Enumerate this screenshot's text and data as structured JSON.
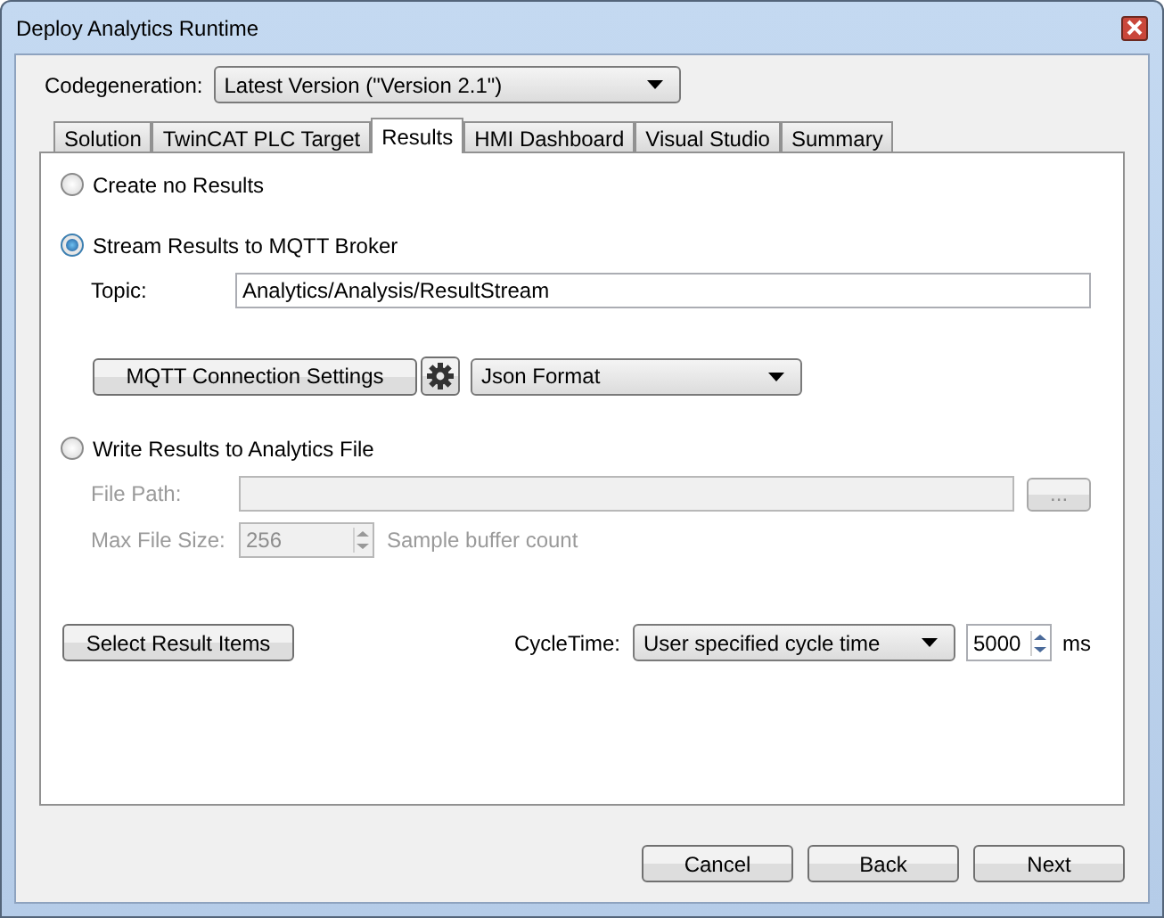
{
  "window": {
    "title": "Deploy Analytics Runtime"
  },
  "codegeneration": {
    "label": "Codegeneration:",
    "value": "Latest Version (\"Version 2.1\")"
  },
  "tabs": [
    {
      "label": "Solution",
      "selected": false
    },
    {
      "label": "TwinCAT PLC Target",
      "selected": false
    },
    {
      "label": "Results",
      "selected": true
    },
    {
      "label": "HMI Dashboard",
      "selected": false
    },
    {
      "label": "Visual Studio",
      "selected": false
    },
    {
      "label": "Summary",
      "selected": false
    }
  ],
  "output_options": [
    {
      "label": "Create no Results",
      "selected": false
    },
    {
      "label": "Stream Results to MQTT Broker",
      "selected": true
    },
    {
      "label": "Write Results to Analytics File",
      "selected": false
    }
  ],
  "mqtt": {
    "topic_label": "Topic:",
    "topic": "Analytics/Analysis/ResultStream",
    "settings_button": "MQTT Connection Settings",
    "format": "Json Format"
  },
  "file": {
    "disabled": true,
    "path_label": "File Path:",
    "browse_button": "...",
    "size_label": "Max File Size:",
    "size": "256",
    "size_unit": "Sample buffer count"
  },
  "select_button": "Select Result Items",
  "cycle": {
    "label": "CycleTime:",
    "mode": "User specified cycle time",
    "value": "5000",
    "unit": "ms"
  },
  "buttons": [
    "Cancel",
    "Back",
    "Next"
  ]
}
